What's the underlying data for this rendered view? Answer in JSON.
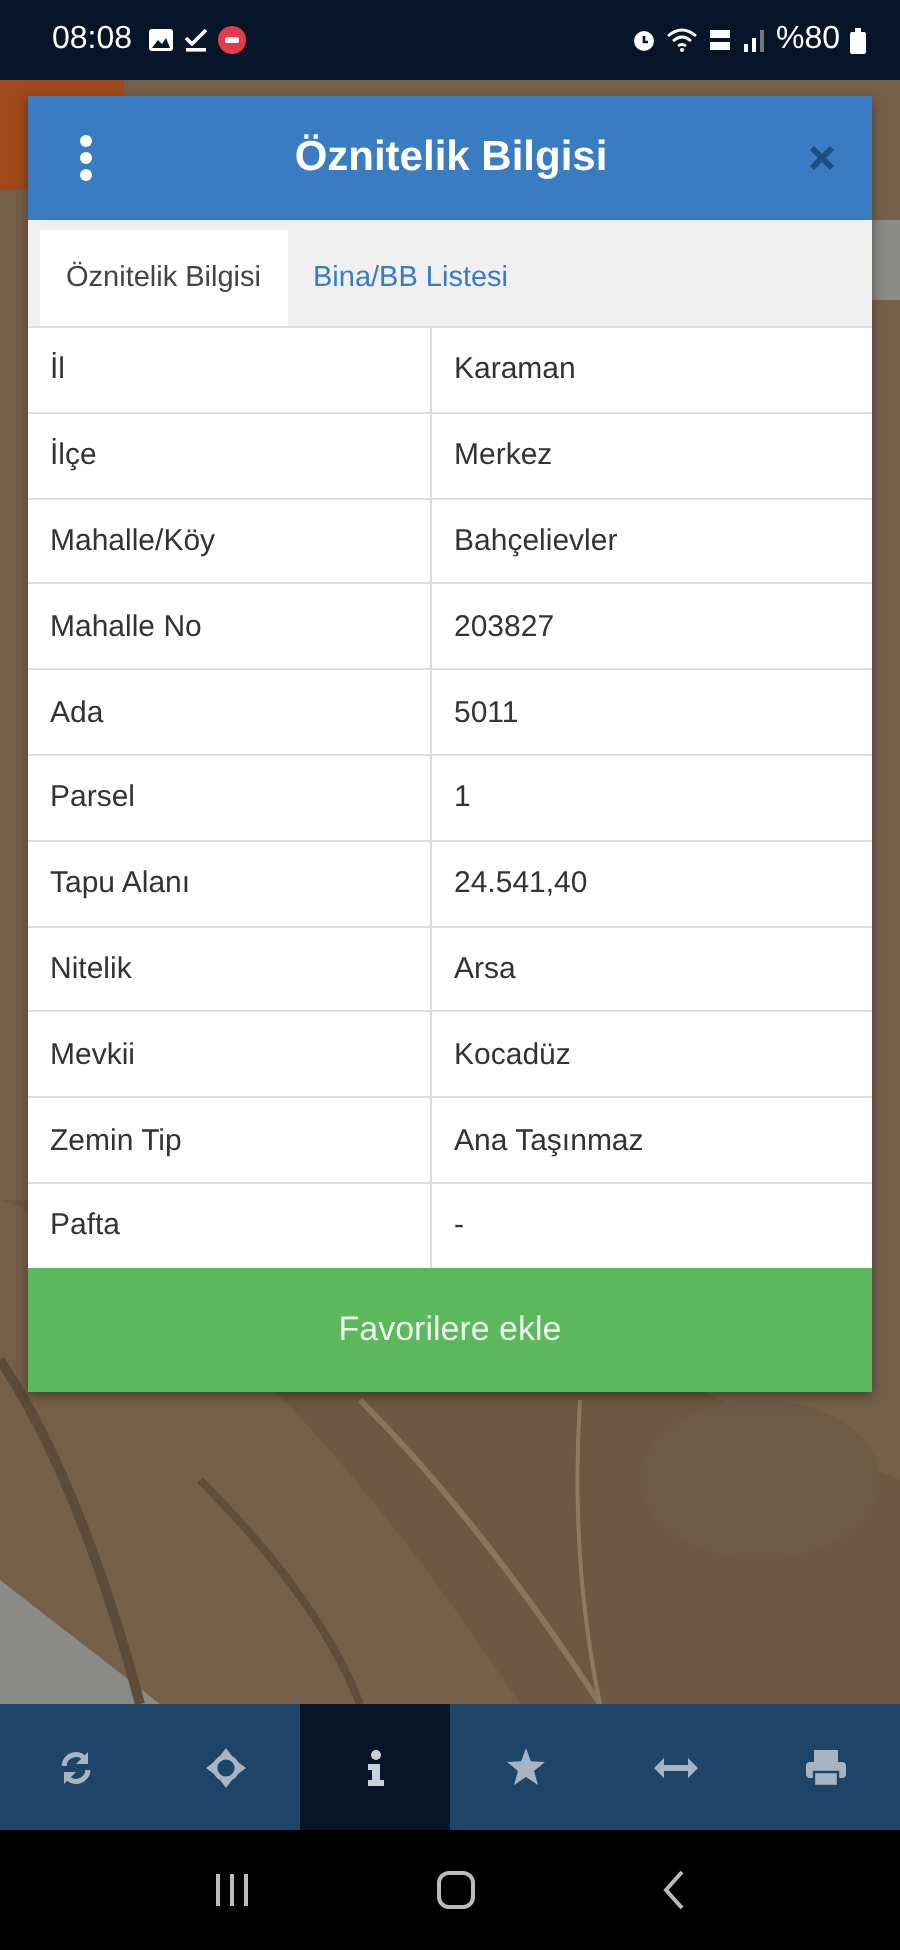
{
  "status_bar": {
    "time": "08:08",
    "battery": "%80"
  },
  "dialog": {
    "title": "Öznitelik Bilgisi",
    "tabs": [
      {
        "label": "Öznitelik Bilgisi",
        "selected": true
      },
      {
        "label": "Bina/BB Listesi",
        "selected": false
      }
    ],
    "rows": [
      {
        "field": "İl",
        "value": "Karaman"
      },
      {
        "field": "İlçe",
        "value": "Merkez"
      },
      {
        "field": "Mahalle/Köy",
        "value": "Bahçelievler"
      },
      {
        "field": "Mahalle No",
        "value": "203827"
      },
      {
        "field": "Ada",
        "value": "5011"
      },
      {
        "field": "Parsel",
        "value": "1"
      },
      {
        "field": "Tapu Alanı",
        "value": "24.541,40"
      },
      {
        "field": "Nitelik",
        "value": "Arsa"
      },
      {
        "field": "Mevkii",
        "value": "Kocadüz"
      },
      {
        "field": "Zemin Tip",
        "value": "Ana Taşınmaz"
      },
      {
        "field": "Pafta",
        "value": "-"
      }
    ],
    "button": "Favorilere ekle"
  },
  "toolbar": [
    {
      "kind": "refresh",
      "selected": false
    },
    {
      "kind": "locate",
      "selected": false
    },
    {
      "kind": "info",
      "selected": true
    },
    {
      "kind": "favorite",
      "selected": false
    },
    {
      "kind": "measure",
      "selected": false
    },
    {
      "kind": "print",
      "selected": false
    }
  ]
}
